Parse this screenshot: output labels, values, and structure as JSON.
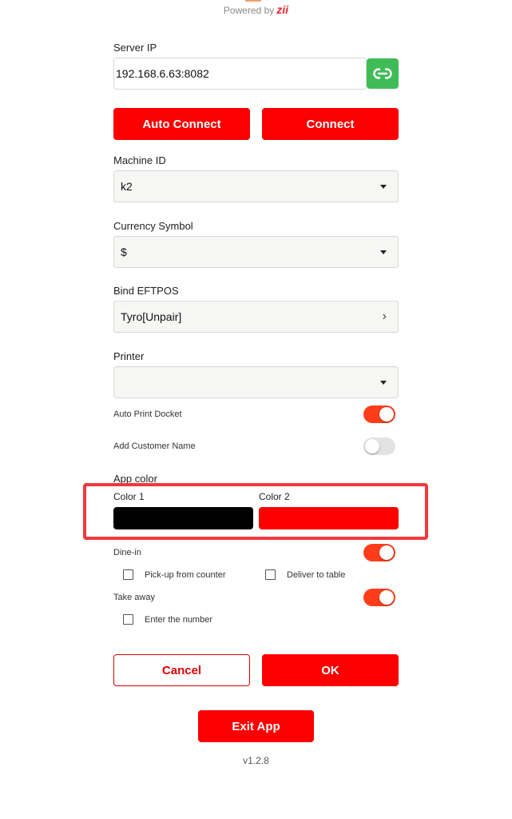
{
  "branding": {
    "powered_prefix": "Powered by",
    "brand": "zii"
  },
  "server": {
    "label": "Server IP",
    "value": "192.168.6.63:8082"
  },
  "connect": {
    "auto_label": "Auto Connect",
    "connect_label": "Connect"
  },
  "machine": {
    "label": "Machine ID",
    "value": "k2"
  },
  "currency": {
    "label": "Currency Symbol",
    "value": "$"
  },
  "eftpos": {
    "label": "Bind EFTPOS",
    "value": "Tyro[Unpair]"
  },
  "printer": {
    "label": "Printer",
    "value": ""
  },
  "auto_print": {
    "label": "Auto Print Docket",
    "on": true
  },
  "customer_name": {
    "label": "Add Customer Name",
    "on": false
  },
  "app_color": {
    "label": "App color",
    "color1_label": "Color 1",
    "color1": "#000000",
    "color2_label": "Color 2",
    "color2": "#fc0000"
  },
  "dine_in": {
    "label": "Dine-in",
    "on": true,
    "pickup_label": "Pick-up from counter",
    "pickup_checked": false,
    "deliver_label": "Deliver to table",
    "deliver_checked": false
  },
  "take_away": {
    "label": "Take away",
    "on": true,
    "number_label": "Enter the number",
    "number_checked": false
  },
  "actions": {
    "cancel_label": "Cancel",
    "ok_label": "OK",
    "exit_label": "Exit App"
  },
  "version": "v1.2.8",
  "colors": {
    "accent": "#fc0000",
    "toggle_on": "#ff3d1a",
    "link_button": "#3fbc57",
    "highlight": "#f0383d"
  }
}
